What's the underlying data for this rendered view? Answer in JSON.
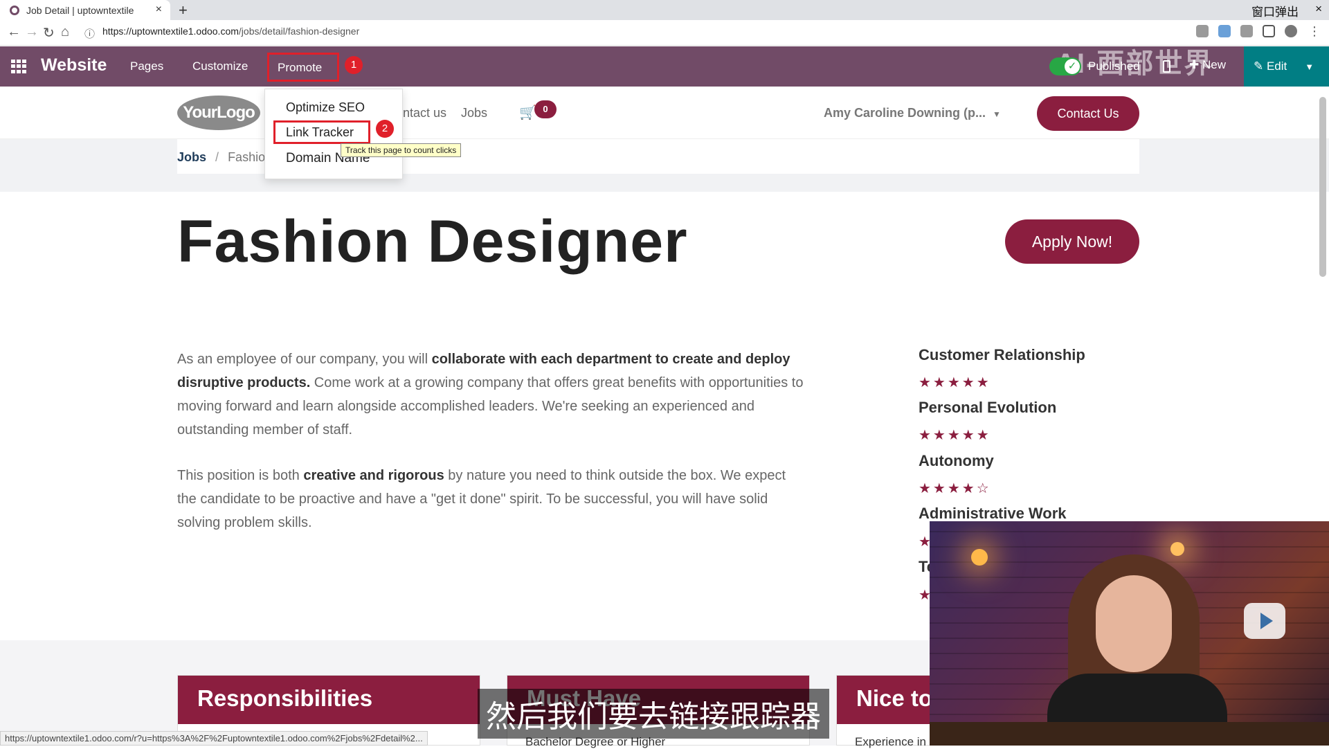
{
  "browser": {
    "tab_title": "Job Detail | uptowntextile",
    "tab_close": "×",
    "new_tab": "+",
    "window_popout": "窗口弹出",
    "window_close": "×",
    "url_host": "https://uptowntextile1.odoo.com",
    "url_path": "/jobs/detail/fashion-designer"
  },
  "odoo_bar": {
    "brand": "Website",
    "menu": [
      "Pages",
      "Customize",
      "Promote"
    ],
    "step1": "1",
    "published_label": "Published",
    "new_label": "New",
    "edit_label": "Edit",
    "watermark": "AI-西部世界"
  },
  "promote_menu": {
    "items": [
      "Optimize SEO",
      "Link Tracker",
      "Domain Name"
    ],
    "step2": "2",
    "tooltip": "Track this page to count clicks"
  },
  "site_header": {
    "logo_text": "YourLogo",
    "nav": [
      "ntact us",
      "Jobs"
    ],
    "cart_count": "0",
    "user": "Amy Caroline Downing (p...",
    "contact_button": "Contact Us"
  },
  "breadcrumb": {
    "root": "Jobs",
    "separator": "/",
    "current": "Fashion"
  },
  "job": {
    "title": "Fashion Designer",
    "apply_button": "Apply Now!",
    "para1_a": "As an employee of our company, you will ",
    "para1_b": "collaborate with each department to create and deploy disruptive products.",
    "para1_c": " Come work at a growing company that offers great benefits with opportunities to moving forward and learn alongside accomplished leaders. We're seeking an experienced and outstanding member of staff.",
    "para2_a": "This position is both ",
    "para2_b": "creative and rigorous",
    "para2_c": " by nature you need to think outside the box. We expect the candidate to be proactive and have a \"get it done\" spirit. To be successful, you will have solid solving problem skills."
  },
  "skills": [
    {
      "name": "Customer Relationship",
      "stars": "★★★★★",
      "rating": 5
    },
    {
      "name": "Personal Evolution",
      "stars": "★★★★★",
      "rating": 5
    },
    {
      "name": "Autonomy",
      "stars": "★★★★☆",
      "rating": 4
    },
    {
      "name": "Administrative Work",
      "stars": "★",
      "rating": null
    },
    {
      "name": "Te",
      "stars": "★",
      "rating": null
    }
  ],
  "cards": [
    {
      "title": "Responsibilities",
      "item": ""
    },
    {
      "title": "Must Have",
      "item": "Bachelor Degree or Higher"
    },
    {
      "title": "Nice to",
      "item": "Experience in"
    }
  ],
  "status_url": "https://uptowntextile1.odoo.com/r?u=https%3A%2F%2Fuptowntextile1.odoo.com%2Fjobs%2Fdetail%2...",
  "subtitle": "然后我们要去链接跟踪器",
  "colors": {
    "odoo_purple": "#714b67",
    "brand_maroon": "#8b1e3f",
    "edit_teal": "#017e84",
    "highlight_red": "#e0202a"
  }
}
